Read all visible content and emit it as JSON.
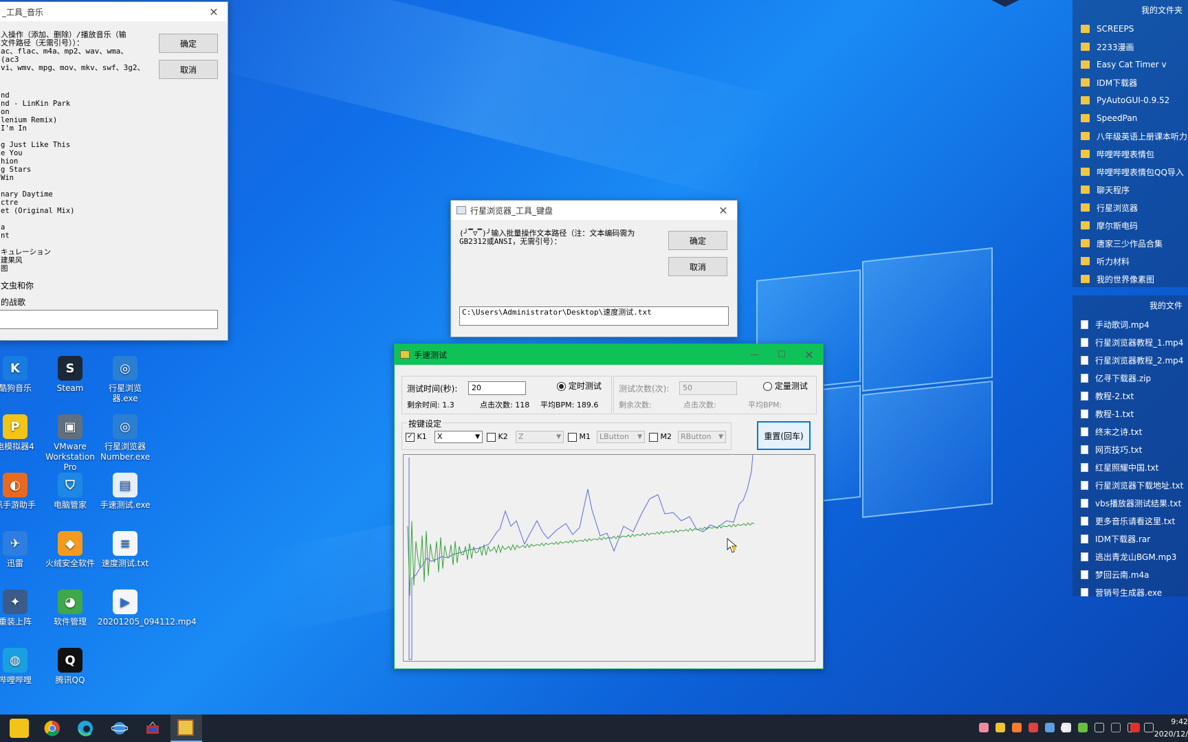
{
  "music_window": {
    "title": "_工具_音乐",
    "prompt_lines": [
      "入操作（添加、删除）/播放音乐（输",
      "文件路径（无需引号））：",
      "ac、flac、m4a、mp2、wav、wma、(ac3",
      "",
      "vi、wmv、mpg、mov、mkv、swf、3g2、"
    ],
    "ok": "确定",
    "cancel": "取消",
    "list": [
      "nd",
      "nd - LinKin Park",
      "on",
      "lenium Remix)",
      "I'm In",
      "",
      "g Just Like This",
      "e You",
      "hion",
      "g Stars",
      "Win",
      "",
      "nary Daytime",
      "ctre",
      "et (Original Mix)",
      "",
      "a",
      "nt",
      "",
      "キュレーション",
      "建果风",
      "图"
    ],
    "tail1": "文虫和你",
    "tail2": "的战歌",
    "input_value": ""
  },
  "keyboard_window": {
    "title": "行星浏览器_工具_键盘",
    "prompt": "(╯▔▽▔)╯输入批量操作文本路径（注：文本编码需为GB2312或ANSI，无需引号）：",
    "ok": "确定",
    "cancel": "取消",
    "path_value": "C:\\Users\\Administrator\\Desktop\\速度测试.txt"
  },
  "speed_window": {
    "title": "手速测试",
    "time_label": "测试时间(秒):",
    "time_value": "20",
    "timed_radio": "定时测试",
    "count_label": "测试次数(次):",
    "count_value": "50",
    "fixed_radio": "定量测试",
    "remaining_time": "剩余时间: 1.3",
    "clicks": "点击次数: 118",
    "avg_bpm": "平均BPM: 189.6",
    "remaining_count": "剩余次数:",
    "clicks2": "点击次数:",
    "avg_bpm2": "平均BPM:",
    "keys_group": "按键设定",
    "k1": "K1",
    "k1_value": "X",
    "k2": "K2",
    "k2_value": "Z",
    "m1": "M1",
    "m1_value": "LButton",
    "m2": "M2",
    "m2_value": "RButton",
    "reset": "重置(回车)"
  },
  "desktop_icons": [
    {
      "label": "酷狗音乐",
      "color": "#1a7be0",
      "glyph": "K"
    },
    {
      "label": "Steam",
      "color": "#1b2838",
      "glyph": "S"
    },
    {
      "label": "行星浏览器.exe",
      "color": "#2a7fd4",
      "glyph": "◎"
    },
    {
      "label": "电模拟器4",
      "color": "#f2c418",
      "glyph": "P"
    },
    {
      "label": "VMware Workstation Pro",
      "color": "#607080",
      "glyph": "▣"
    },
    {
      "label": "行星浏览器Number.exe",
      "color": "#2a7fd4",
      "glyph": "◎"
    },
    {
      "label": "讯手游助手",
      "color": "#e96a1e",
      "glyph": "◐"
    },
    {
      "label": "电脑管家",
      "color": "#1e88e5",
      "glyph": "⛉"
    },
    {
      "label": "手速测试.exe",
      "color": "#e8eef6",
      "glyph": "▤"
    },
    {
      "label": "迅雷",
      "color": "#2d7ee0",
      "glyph": "✈"
    },
    {
      "label": "火绒安全软件",
      "color": "#f39a1e",
      "glyph": "◆"
    },
    {
      "label": "速度测试.txt",
      "color": "#f4f6f8",
      "glyph": "≡"
    },
    {
      "label": "重装上阵",
      "color": "#3b5b8a",
      "glyph": "✦"
    },
    {
      "label": "软件管理",
      "color": "#3ea84a",
      "glyph": "◕"
    },
    {
      "label": "20201205_094112.mp4",
      "color": "#f4f6f8",
      "glyph": "▶"
    },
    {
      "label": "哔哩哔哩",
      "color": "#1aa0e0",
      "glyph": "◍"
    },
    {
      "label": "腾讯QQ",
      "color": "#111",
      "glyph": "Q"
    }
  ],
  "folders_panel": {
    "title": "我的文件夹",
    "items": [
      "SCREEPS",
      "2233漫画",
      "Easy Cat Timer v",
      "IDM下载器",
      "PyAutoGUI-0.9.52",
      "SpeedPan",
      "八年级英语上册课本听力",
      "哔哩哔哩表情包",
      "哔哩哔哩表情包QQ导入",
      "聊天程序",
      "行星浏览器",
      "摩尔斯电码",
      "唐家三少作品合集",
      "听力材料",
      "我的世界像素图"
    ]
  },
  "files_panel": {
    "title": "我的文件",
    "items": [
      "手动歌词.mp4",
      "行星浏览器教程_1.mp4",
      "行星浏览器教程_2.mp4",
      "亿寻下载器.zip",
      "教程-2.txt",
      "教程-1.txt",
      "终末之诗.txt",
      "网页技巧.txt",
      "红星照耀中国.txt",
      "行星浏览器下载地址.txt",
      "vbs播放器测试结果.txt",
      "更多音乐请看这里.txt",
      "IDM下载器.rar",
      "逃出青龙山BGM.mp3",
      "梦回云南.m4a",
      "营销号生成器.exe"
    ]
  },
  "taskbar": {
    "time": "9:42",
    "date": "2020/12/",
    "ime": "中",
    "colors": {
      "bg": "#1b2430"
    }
  }
}
